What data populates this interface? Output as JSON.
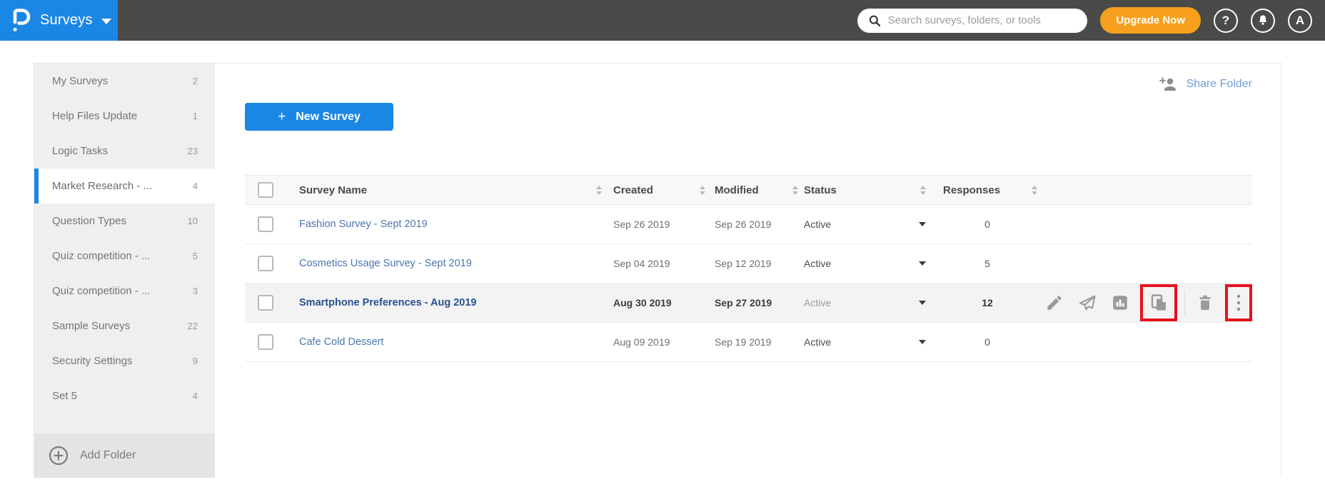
{
  "colors": {
    "brand_blue": "#1b87e4",
    "topbar_dark": "#4a4a48",
    "upgrade_orange": "#f7a01d",
    "highlight_red": "#e8101d",
    "link_blue": "#4a76ad"
  },
  "topbar": {
    "product_name": "Surveys",
    "search_placeholder": "Search surveys, folders, or tools",
    "upgrade_label": "Upgrade Now",
    "help_glyph": "?",
    "avatar_letter": "A"
  },
  "sidebar": {
    "items": [
      {
        "label": "My Surveys",
        "count": "2",
        "selected": false
      },
      {
        "label": "Help Files Update",
        "count": "1",
        "selected": false
      },
      {
        "label": "Logic Tasks",
        "count": "23",
        "selected": false
      },
      {
        "label": "Market Research - ...",
        "count": "4",
        "selected": true
      },
      {
        "label": "Question Types",
        "count": "10",
        "selected": false
      },
      {
        "label": "Quiz competition - ...",
        "count": "5",
        "selected": false
      },
      {
        "label": "Quiz competition - ...",
        "count": "3",
        "selected": false
      },
      {
        "label": "Sample Surveys",
        "count": "22",
        "selected": false
      },
      {
        "label": "Security Settings",
        "count": "9",
        "selected": false
      },
      {
        "label": "Set 5",
        "count": "4",
        "selected": false
      }
    ],
    "add_folder_label": "Add Folder"
  },
  "main": {
    "share_folder_label": "Share Folder",
    "new_survey": {
      "plus": "+",
      "label": "New Survey"
    },
    "table": {
      "headers": {
        "name": "Survey Name",
        "created": "Created",
        "modified": "Modified",
        "status": "Status",
        "responses": "Responses"
      },
      "rows": [
        {
          "name": "Fashion Survey - Sept 2019",
          "created": "Sep 26 2019",
          "modified": "Sep 26 2019",
          "status": "Active",
          "responses": "0"
        },
        {
          "name": "Cosmetics Usage Survey - Sept 2019",
          "created": "Sep 04 2019",
          "modified": "Sep 12 2019",
          "status": "Active",
          "responses": "5"
        },
        {
          "name": "Smartphone Preferences - Aug 2019",
          "created": "Aug 30 2019",
          "modified": "Sep 27 2019",
          "status": "Active",
          "responses": "12",
          "highlighted": true,
          "actions": [
            "edit",
            "send",
            "reports",
            "copy",
            "delete",
            "more"
          ]
        },
        {
          "name": "Cafe Cold Dessert",
          "created": "Aug 09 2019",
          "modified": "Sep 19 2019",
          "status": "Active",
          "responses": "0"
        }
      ]
    }
  }
}
